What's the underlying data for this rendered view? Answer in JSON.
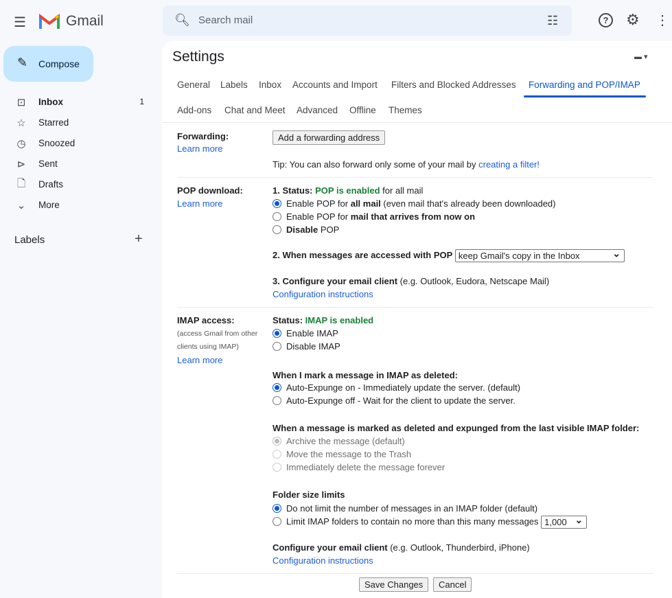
{
  "app": {
    "name": "Gmail",
    "search_placeholder": "Search mail"
  },
  "colors": {
    "accent": "#0b57d0",
    "compose_bg": "#c2e7ff",
    "status_green": "#188038",
    "link": "#1a5ed9"
  },
  "sidebar": {
    "compose": "Compose",
    "items": [
      {
        "label": "Inbox",
        "count": "1",
        "icon": "inbox-icon"
      },
      {
        "label": "Starred",
        "icon": "star-icon"
      },
      {
        "label": "Snoozed",
        "icon": "clock-icon"
      },
      {
        "label": "Sent",
        "icon": "send-icon"
      },
      {
        "label": "Drafts",
        "icon": "draft-icon"
      },
      {
        "label": "More",
        "icon": "chevron-down-icon"
      }
    ],
    "labels_heading": "Labels"
  },
  "settings": {
    "title": "Settings",
    "tabs": [
      "General",
      "Labels",
      "Inbox",
      "Accounts and Import",
      "Filters and Blocked Addresses",
      "Forwarding and POP/IMAP",
      "Add-ons",
      "Chat and Meet",
      "Advanced",
      "Offline",
      "Themes"
    ],
    "active_tab": "Forwarding and POP/IMAP",
    "forwarding": {
      "label": "Forwarding:",
      "learn": "Learn more",
      "button": "Add a forwarding address",
      "tip": "Tip: You can also forward only some of your mail by ",
      "tip_link": "creating a filter!"
    },
    "pop": {
      "label": "POP download:",
      "learn": "Learn more",
      "status_prefix": "1. Status: ",
      "status": "POP is enabled",
      "status_suffix": " for all mail",
      "r1a": "Enable POP for ",
      "r1b": "all mail",
      "r1c": " (even mail that's already been downloaded)",
      "r2a": "Enable POP for ",
      "r2b": "mail that arrives from now on",
      "r3a": "Disable",
      "r3b": " POP",
      "when": "2. When messages are accessed with POP",
      "when_value": "keep Gmail's copy in the Inbox",
      "config": "3. Configure your email client",
      "config_eg": " (e.g. Outlook, Eudora, Netscape Mail)",
      "config_link": "Configuration instructions"
    },
    "imap": {
      "label": "IMAP access:",
      "sub1": "(access Gmail from other",
      "sub2": "clients using IMAP)",
      "learn": "Learn more",
      "status_prefix": "Status: ",
      "status": "IMAP is enabled",
      "enable": "Enable IMAP",
      "disable": "Disable IMAP",
      "deleted_heading": "When I mark a message in IMAP as deleted:",
      "exp_on": "Auto-Expunge on - Immediately update the server. (default)",
      "exp_off": "Auto-Expunge off - Wait for the client to update the server.",
      "expunged_heading": "When a message is marked as deleted and expunged from the last visible IMAP folder:",
      "archive": "Archive the message (default)",
      "trash": "Move the message to the Trash",
      "delete": "Immediately delete the message forever",
      "folder_heading": "Folder size limits",
      "nolimit": "Do not limit the number of messages in an IMAP folder (default)",
      "limit": "Limit IMAP folders to contain no more than this many messages",
      "limit_value": "1,000",
      "config": "Configure your email client",
      "config_eg": " (e.g. Outlook, Thunderbird, iPhone)",
      "config_link": "Configuration instructions"
    },
    "save": "Save Changes",
    "cancel": "Cancel"
  }
}
